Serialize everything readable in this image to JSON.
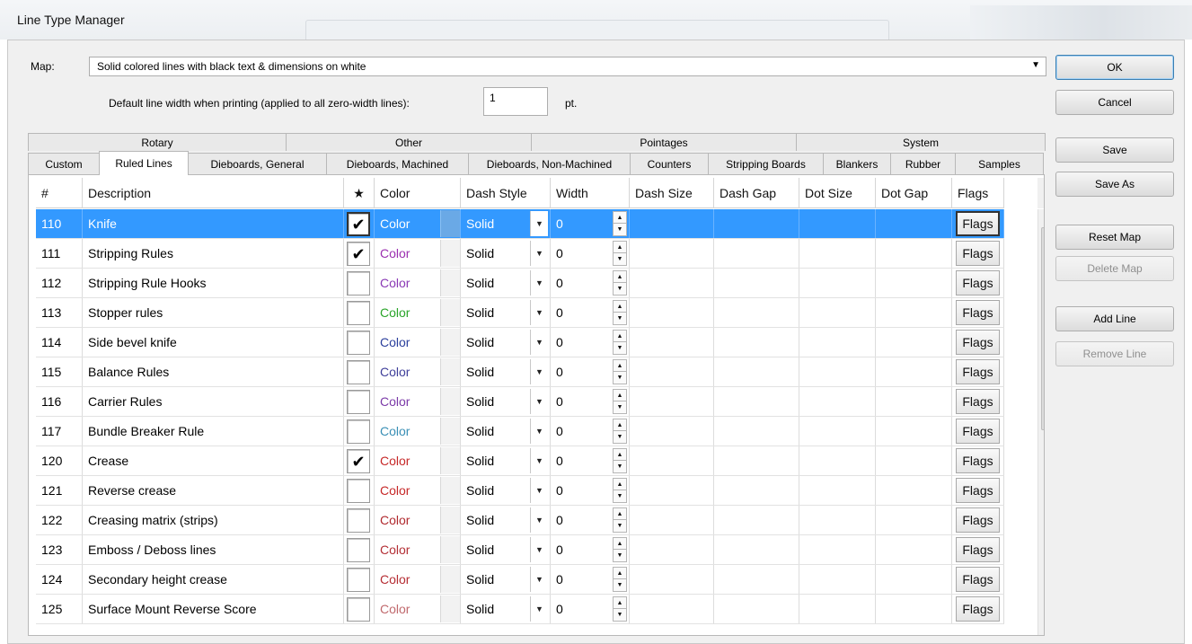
{
  "window": {
    "title": "Line Type Manager"
  },
  "map": {
    "label": "Map:",
    "value": "Solid colored lines with black text & dimensions on white"
  },
  "default_width": {
    "label": "Default line width when printing (applied to all zero-width lines):",
    "value": "1",
    "unit": "pt."
  },
  "buttons": {
    "ok": "OK",
    "cancel": "Cancel",
    "save": "Save",
    "save_as": "Save As",
    "reset_map": "Reset Map",
    "delete_map": "Delete Map",
    "add_line": "Add Line",
    "remove_line": "Remove Line"
  },
  "tabs_top": [
    "Rotary",
    "Other",
    "Pointages",
    "System"
  ],
  "tabs_bottom": [
    "Custom",
    "Ruled Lines",
    "Dieboards, General",
    "Dieboards, Machined",
    "Dieboards, Non-Machined",
    "Counters",
    "Stripping Boards",
    "Blankers",
    "Rubber",
    "Samples"
  ],
  "active_tab": "Ruled Lines",
  "columns": [
    "#",
    "Description",
    "★",
    "Color",
    "Dash Style",
    "Width",
    "Dash Size",
    "Dash Gap",
    "Dot Size",
    "Dot Gap",
    "Flags"
  ],
  "rows": [
    {
      "num": "110",
      "desc": "Knife",
      "checked": true,
      "color_label": "Color",
      "color_hex": "#ffffff",
      "dash": "Solid",
      "width": "0",
      "flags": "Flags",
      "selected": true
    },
    {
      "num": "111",
      "desc": "Stripping Rules",
      "checked": true,
      "color_label": "Color",
      "color_hex": "#9b2fb0",
      "dash": "Solid",
      "width": "0",
      "flags": "Flags"
    },
    {
      "num": "112",
      "desc": "Stripping Rule Hooks",
      "checked": false,
      "color_label": "Color",
      "color_hex": "#8a39b5",
      "dash": "Solid",
      "width": "0",
      "flags": "Flags"
    },
    {
      "num": "113",
      "desc": "Stopper rules",
      "checked": false,
      "color_label": "Color",
      "color_hex": "#2aa52a",
      "dash": "Solid",
      "width": "0",
      "flags": "Flags"
    },
    {
      "num": "114",
      "desc": "Side bevel knife",
      "checked": false,
      "color_label": "Color",
      "color_hex": "#2b3f9c",
      "dash": "Solid",
      "width": "0",
      "flags": "Flags"
    },
    {
      "num": "115",
      "desc": "Balance Rules",
      "checked": false,
      "color_label": "Color",
      "color_hex": "#3f3f9a",
      "dash": "Solid",
      "width": "0",
      "flags": "Flags"
    },
    {
      "num": "116",
      "desc": "Carrier Rules",
      "checked": false,
      "color_label": "Color",
      "color_hex": "#7b3aa8",
      "dash": "Solid",
      "width": "0",
      "flags": "Flags"
    },
    {
      "num": "117",
      "desc": "Bundle Breaker Rule",
      "checked": false,
      "color_label": "Color",
      "color_hex": "#3a8fb5",
      "dash": "Solid",
      "width": "0",
      "flags": "Flags"
    },
    {
      "num": "120",
      "desc": "Crease",
      "checked": true,
      "color_label": "Color",
      "color_hex": "#c62828",
      "dash": "Solid",
      "width": "0",
      "flags": "Flags"
    },
    {
      "num": "121",
      "desc": "Reverse crease",
      "checked": false,
      "color_label": "Color",
      "color_hex": "#c62828",
      "dash": "Solid",
      "width": "0",
      "flags": "Flags"
    },
    {
      "num": "122",
      "desc": "Creasing matrix (strips)",
      "checked": false,
      "color_label": "Color",
      "color_hex": "#b0292e",
      "dash": "Solid",
      "width": "0",
      "flags": "Flags"
    },
    {
      "num": "123",
      "desc": "Emboss / Deboss lines",
      "checked": false,
      "color_label": "Color",
      "color_hex": "#b32f35",
      "dash": "Solid",
      "width": "0",
      "flags": "Flags"
    },
    {
      "num": "124",
      "desc": "Secondary height crease",
      "checked": false,
      "color_label": "Color",
      "color_hex": "#b52d33",
      "dash": "Solid",
      "width": "0",
      "flags": "Flags"
    },
    {
      "num": "125",
      "desc": "Surface Mount Reverse Score",
      "checked": false,
      "color_label": "Color",
      "color_hex": "#c0696d",
      "dash": "Solid",
      "width": "0",
      "flags": "Flags"
    }
  ]
}
